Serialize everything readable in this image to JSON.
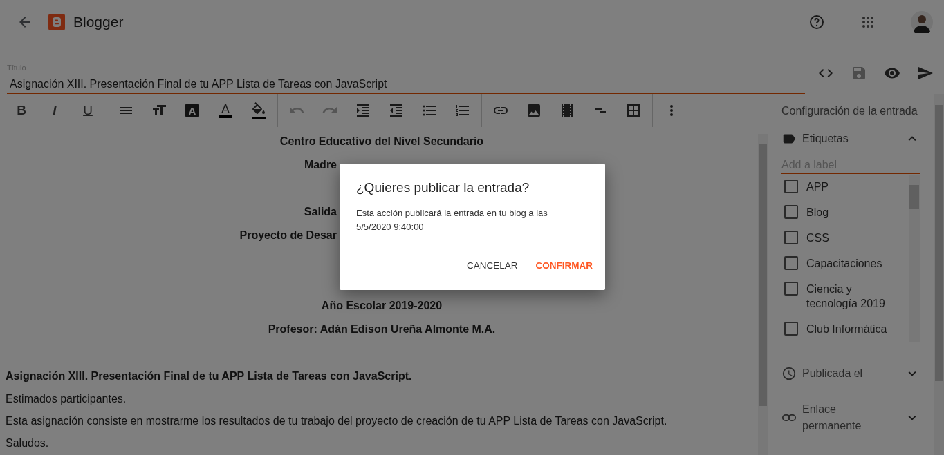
{
  "app": {
    "name": "Blogger"
  },
  "title_field": {
    "label": "Título",
    "value": "Asignación XIII. Presentación Final de tu APP Lista de Tareas con JavaScript"
  },
  "actions": [
    {
      "kind": "html",
      "disabled": false
    },
    {
      "kind": "save",
      "disabled": true
    },
    {
      "kind": "preview",
      "disabled": false
    },
    {
      "kind": "publish",
      "disabled": false
    }
  ],
  "toolbar_groups": [
    [
      {
        "kind": "format",
        "text": "B"
      },
      {
        "kind": "format",
        "text": "I"
      },
      {
        "kind": "format",
        "text": "U"
      }
    ],
    [
      {
        "kind": "align"
      },
      {
        "kind": "size"
      },
      {
        "kind": "highlight",
        "text": "A"
      },
      {
        "kind": "color",
        "text": "A"
      },
      {
        "kind": "fill"
      }
    ],
    [
      {
        "kind": "undo",
        "disabled": true
      },
      {
        "kind": "redo",
        "disabled": true
      },
      {
        "kind": "indent"
      },
      {
        "kind": "outdent"
      },
      {
        "kind": "bullets"
      },
      {
        "kind": "numbers"
      }
    ],
    [
      {
        "kind": "link"
      },
      {
        "kind": "image"
      },
      {
        "kind": "video"
      },
      {
        "kind": "break"
      },
      {
        "kind": "table"
      }
    ],
    [
      {
        "kind": "more"
      }
    ]
  ],
  "content": [
    {
      "kind": "center",
      "text": "Centro Educativo del Nivel Secundario"
    },
    {
      "kind": "cut",
      "text": "Madre"
    },
    {
      "kind": "cut",
      "text": "Salida"
    },
    {
      "kind": "cut",
      "text": "Proyecto de Desar"
    },
    {
      "kind": "center",
      "text": "Año Escolar 2019-2020"
    },
    {
      "kind": "center",
      "text": "Profesor: Adán Edison Ureña Almonte M.A."
    },
    {
      "kind": "heading",
      "text": "Asignación XIII. Presentación Final de tu APP Lista de Tareas con JavaScript."
    },
    {
      "kind": "plain",
      "text": "Estimados participantes."
    },
    {
      "kind": "plain",
      "text": "Esta asignación consiste en mostrarme los resultados de tu trabajo del proyecto de creación de tu APP Lista de Tareas con JavaScript."
    },
    {
      "kind": "plain",
      "text": "Saludos."
    }
  ],
  "sidebar": {
    "title": "Configuración de la entrada",
    "labels_section": {
      "title": "Etiquetas",
      "expanded": true,
      "placeholder": "Add a label",
      "labels": [
        {
          "name": "APP",
          "checked": false
        },
        {
          "name": "Blog",
          "checked": false
        },
        {
          "name": "CSS",
          "checked": false
        },
        {
          "name": "Capacitaciones",
          "checked": false
        },
        {
          "name": "Ciencia y tecnología 2019",
          "checked": false
        },
        {
          "name": "Club Informática",
          "checked": false
        }
      ]
    },
    "sections": [
      {
        "kind": "clock",
        "title": "Publicada el",
        "expanded": false
      },
      {
        "kind": "link",
        "title": "Enlace permanente",
        "expanded": false
      }
    ]
  },
  "dialog": {
    "title": "¿Quieres publicar la entrada?",
    "message": "Esta acción publicará la entrada en tu blog a las 5/5/2020 9:40:00",
    "buttons": [
      {
        "label": "CANCELAR",
        "primary": false
      },
      {
        "label": "CONFIRMAR",
        "primary": true
      }
    ]
  }
}
